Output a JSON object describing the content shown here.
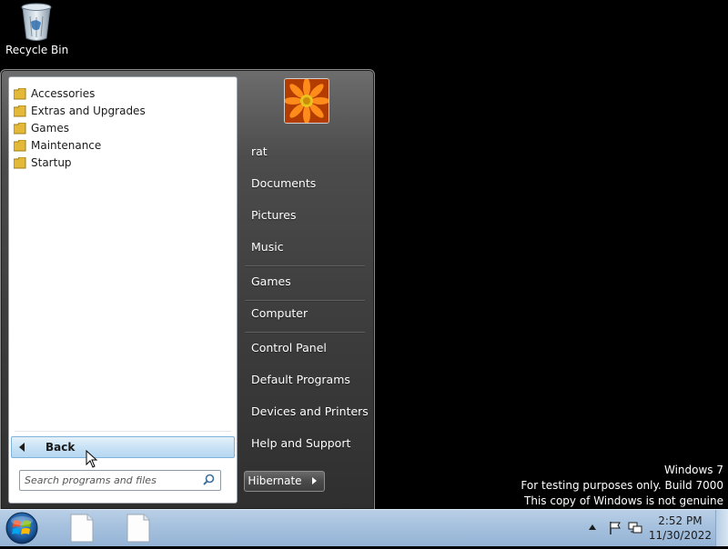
{
  "desktop": {
    "recycle_bin_label": "Recycle Bin",
    "watermark": {
      "line1": "Windows  7",
      "line2": "For testing purposes only. Build 7000",
      "line3": "This copy of Windows is not genuine"
    }
  },
  "start_menu": {
    "programs": [
      {
        "label": "Accessories"
      },
      {
        "label": "Extras and Upgrades"
      },
      {
        "label": "Games"
      },
      {
        "label": "Maintenance"
      },
      {
        "label": "Startup"
      }
    ],
    "back_label": "Back",
    "search_placeholder": "Search programs and files",
    "right_items": [
      {
        "label": "rat"
      },
      {
        "label": "Documents"
      },
      {
        "label": "Pictures"
      },
      {
        "label": "Music"
      },
      {
        "label": "Games"
      },
      {
        "label": "Computer"
      },
      {
        "label": "Control Panel"
      },
      {
        "label": "Default Programs"
      },
      {
        "label": "Devices and Printers"
      },
      {
        "label": "Help and Support"
      }
    ],
    "hibernate_label": "Hibernate"
  },
  "taskbar": {
    "time": "2:52 PM",
    "date": "11/30/2022"
  },
  "colors": {
    "taskbar": "#a6c1de",
    "back_button": "#c9e2f5",
    "desktop": "#000000"
  },
  "icons": [
    "recycle-bin-icon",
    "folder-icon",
    "search-icon",
    "start-orb-icon",
    "document-icon",
    "flag-icon",
    "network-icon",
    "tray-arrow-icon",
    "user-picture-flower"
  ]
}
